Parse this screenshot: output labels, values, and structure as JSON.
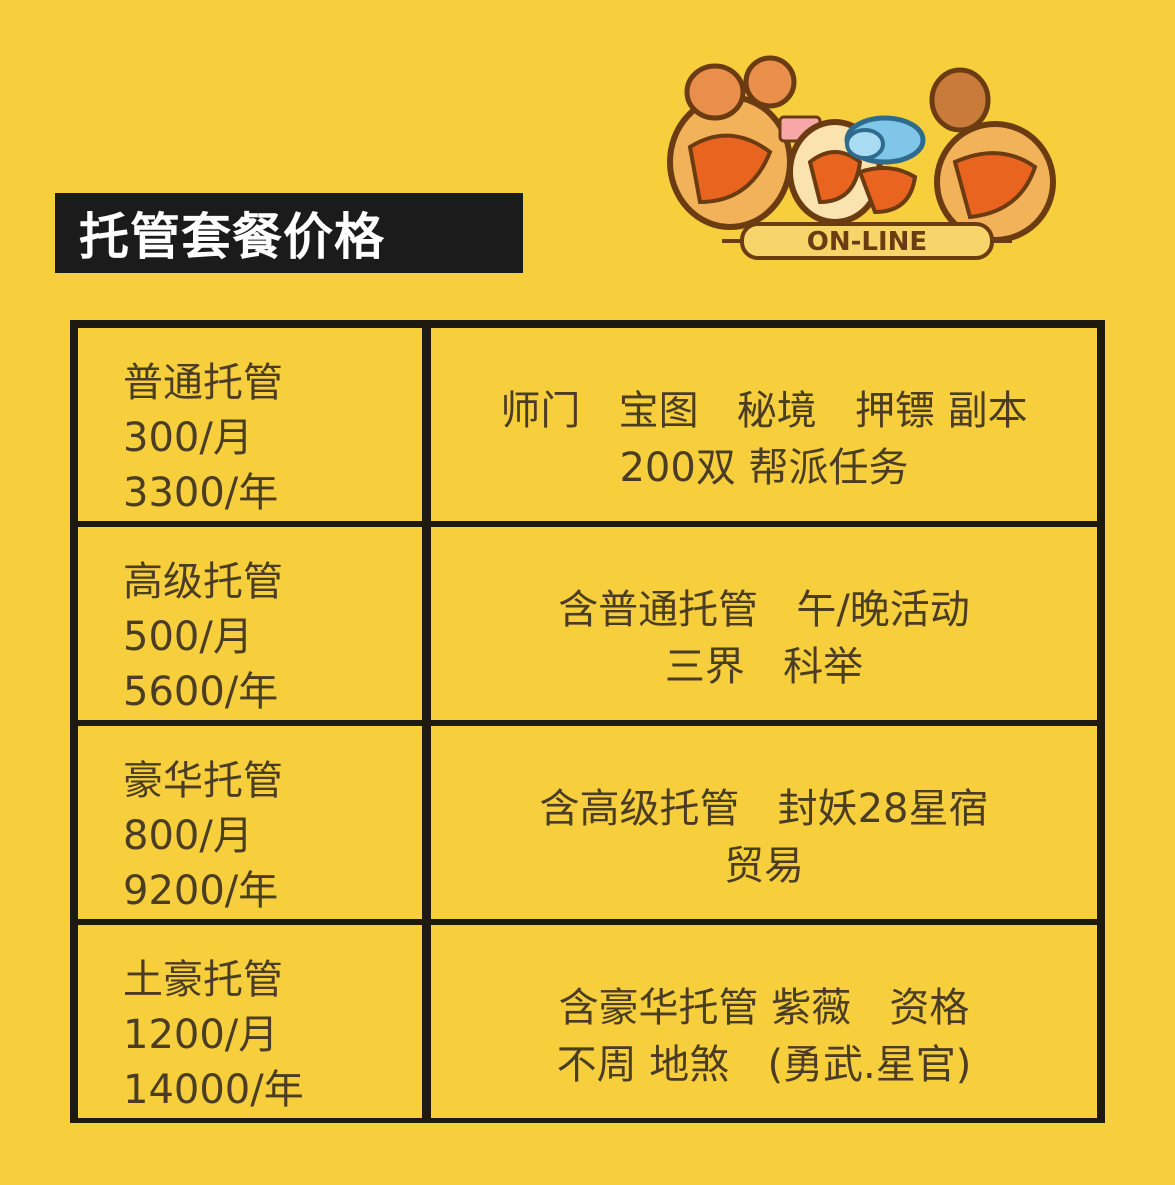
{
  "title": "托管套餐价格",
  "logo": {
    "text": "ON-LINE"
  },
  "plans": [
    {
      "name": "普通托管",
      "monthly": "300/月",
      "yearly": "3300/年",
      "desc_line1": "师门   宝图   秘境   押镖 副本",
      "desc_line2": "200双 帮派任务"
    },
    {
      "name": "高级托管",
      "monthly": "500/月",
      "yearly": "5600/年",
      "desc_line1": "含普通托管   午/晚活动",
      "desc_line2": "三界   科举"
    },
    {
      "name": "豪华托管",
      "monthly": "800/月",
      "yearly": "9200/年",
      "desc_line1": "含高级托管   封妖28星宿",
      "desc_line2": "贸易"
    },
    {
      "name": "土豪托管",
      "monthly": "1200/月",
      "yearly": "14000/年",
      "desc_line1": "含豪华托管 紫薇   资格",
      "desc_line2": "不周 地煞   (勇武.星官)"
    }
  ]
}
